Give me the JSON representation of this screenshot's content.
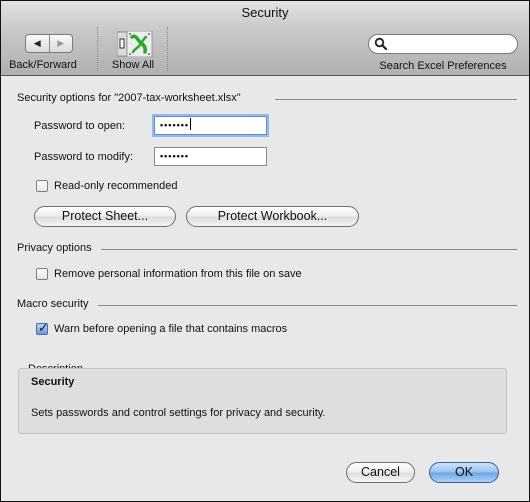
{
  "window": {
    "title": "Security"
  },
  "toolbar": {
    "back_forward_label": "Back/Forward",
    "back_icon": "left-triangle",
    "forward_icon": "right-triangle",
    "show_all_label": "Show All",
    "show_all_icon": "excel-preferences-icon",
    "search_placeholder": "",
    "search_value": "",
    "search_label": "Search Excel Preferences"
  },
  "security_section": {
    "heading": "Security options for \"2007-tax-worksheet.xlsx\"",
    "password_open_label": "Password to open:",
    "password_open_value": "•••••••",
    "password_modify_label": "Password to modify:",
    "password_modify_value": "•••••••",
    "read_only_label": "Read-only recommended",
    "read_only_checked": false,
    "protect_sheet_label": "Protect Sheet...",
    "protect_workbook_label": "Protect Workbook..."
  },
  "privacy_section": {
    "heading": "Privacy options",
    "remove_personal_label": "Remove personal information from this file on save",
    "remove_personal_checked": false
  },
  "macro_section": {
    "heading": "Macro security",
    "warn_macros_label": "Warn before opening a file that contains macros",
    "warn_macros_checked": true
  },
  "description": {
    "heading": "Description",
    "title": "Security",
    "text": "Sets passwords and control settings for privacy and security."
  },
  "buttons": {
    "cancel": "Cancel",
    "ok": "OK"
  },
  "colors": {
    "focus_ring": "#92b9ea",
    "default_button": "#6fa5e6",
    "window_bg": "#e8e8e8"
  }
}
